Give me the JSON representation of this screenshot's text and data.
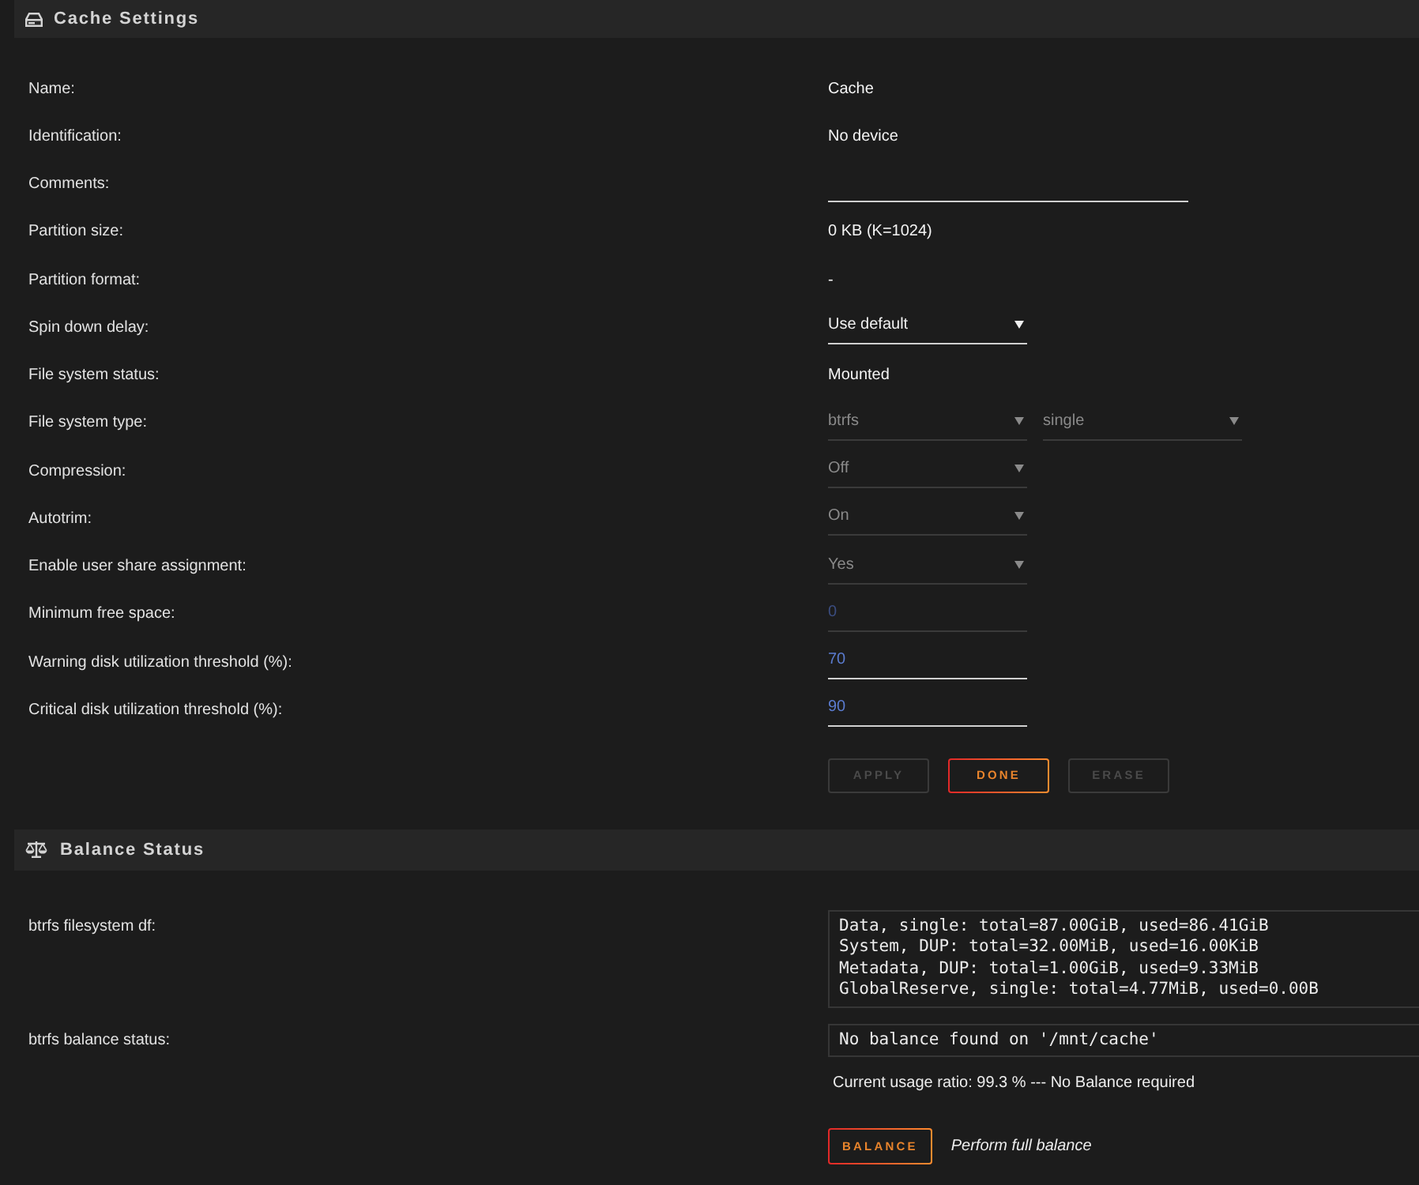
{
  "cache_settings": {
    "title": "Cache Settings",
    "rows": [
      {
        "label": "Name:",
        "value": "Cache"
      },
      {
        "label": "Identification:",
        "value": "No device"
      },
      {
        "label": "Comments:",
        "fields": [
          {
            "kind": "text",
            "disabled": false
          }
        ]
      },
      {
        "label": "Partition size:",
        "value": "0 KB (K=1024)"
      },
      {
        "label": "Partition format:",
        "value": "-"
      },
      {
        "label": "Spin down delay:",
        "fields": [
          {
            "kind": "select",
            "value": "Use default",
            "disabled": false
          }
        ]
      },
      {
        "label": "File system status:",
        "value": "Mounted"
      },
      {
        "label": "File system type:",
        "fields": [
          {
            "kind": "select",
            "value": "btrfs",
            "disabled": true
          },
          {
            "kind": "select",
            "value": "single",
            "disabled": true
          }
        ]
      },
      {
        "label": "Compression:",
        "fields": [
          {
            "kind": "select",
            "value": "Off",
            "disabled": true
          }
        ]
      },
      {
        "label": "Autotrim:",
        "fields": [
          {
            "kind": "select",
            "value": "On",
            "disabled": true
          }
        ]
      },
      {
        "label": "Enable user share assignment:",
        "fields": [
          {
            "kind": "select",
            "value": "Yes",
            "disabled": true
          }
        ]
      },
      {
        "label": "Minimum free space:",
        "fields": [
          {
            "kind": "number",
            "value": "0",
            "disabled": true
          }
        ]
      },
      {
        "label": "Warning disk utilization threshold (%):",
        "fields": [
          {
            "kind": "number",
            "value": "70",
            "disabled": false
          }
        ]
      },
      {
        "label": "Critical disk utilization threshold (%):",
        "fields": [
          {
            "kind": "number",
            "value": "90",
            "disabled": false
          }
        ]
      }
    ],
    "buttons": [
      {
        "label": "APPLY",
        "disabled": true
      },
      {
        "label": "DONE",
        "disabled": false
      },
      {
        "label": "ERASE",
        "disabled": true
      }
    ]
  },
  "balance_status": {
    "title": "Balance Status",
    "rows": [
      {
        "label": "btrfs filesystem df:",
        "output": [
          "Data, single: total=87.00GiB, used=86.41GiB",
          "System, DUP: total=32.00MiB, used=16.00KiB",
          "Metadata, DUP: total=1.00GiB, used=9.33MiB",
          "GlobalReserve, single: total=4.77MiB, used=0.00B"
        ]
      },
      {
        "label": "btrfs balance status:",
        "output": [
          "No balance found on '/mnt/cache'"
        ]
      }
    ],
    "usage_note": "Current usage ratio: 99.3 % --- No Balance required",
    "balance_button": {
      "label": "BALANCE",
      "disabled": false
    },
    "balance_hint": "Perform full balance"
  }
}
